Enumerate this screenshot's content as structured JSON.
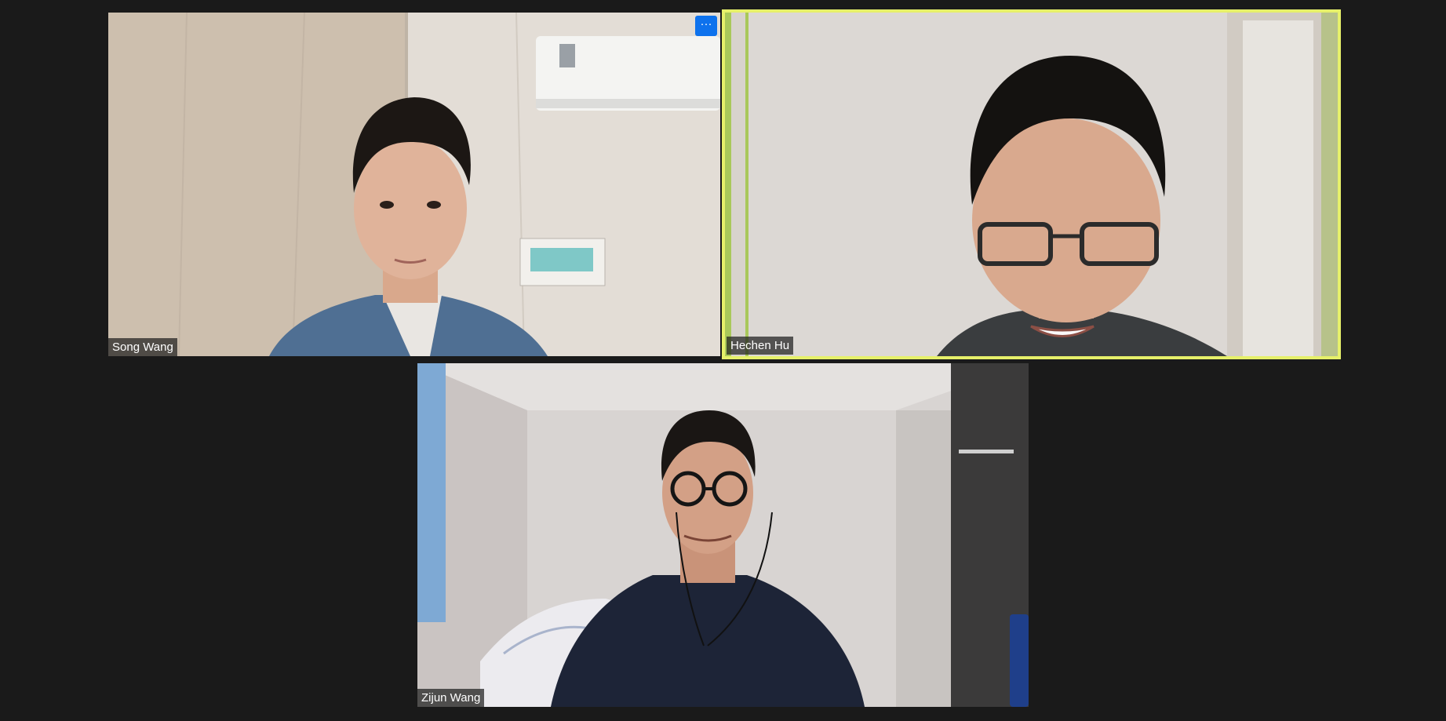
{
  "participants": [
    {
      "name": "Song Wang",
      "active_speaker": false
    },
    {
      "name": "Hechen Hu",
      "active_speaker": true
    },
    {
      "name": "Zijun Wang",
      "active_speaker": false
    }
  ],
  "tile_menu": {
    "label": "···"
  },
  "colors": {
    "background": "#1a1a1a",
    "active_speaker_border": "#e6f06a",
    "menu_button": "#0e72ed",
    "name_label_bg": "#1e1e1e"
  },
  "icons": [
    "more-options-icon"
  ]
}
